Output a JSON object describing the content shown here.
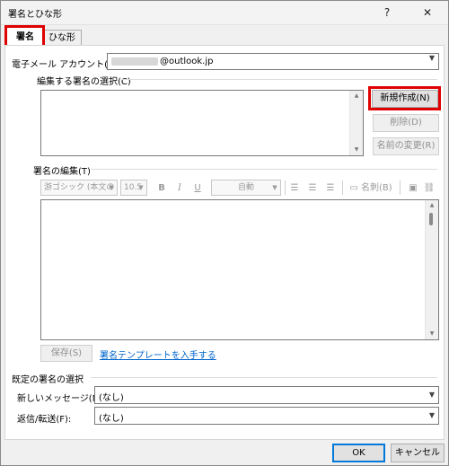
{
  "window": {
    "title": "署名とひな形",
    "help_label": "?",
    "close_label": "✕"
  },
  "tabs": [
    {
      "label": "署名"
    },
    {
      "label": "ひな形"
    }
  ],
  "email": {
    "label": "電子メール アカウント(A):",
    "value_suffix": "@outlook.jp"
  },
  "select_section": {
    "label": "編集する署名の選択(C)"
  },
  "buttons": {
    "new": "新規作成(N)",
    "delete": "削除(D)",
    "rename": "名前の変更(R)",
    "save": "保存(S)",
    "ok": "OK",
    "cancel": "キャンセル"
  },
  "edit_section": {
    "label": "署名の編集(T)"
  },
  "toolbar": {
    "font": "游ゴシック (本文の",
    "size": "10.5",
    "bold": "B",
    "italic": "I",
    "underline": "U",
    "color": "自動",
    "business_card": "名刺(B)"
  },
  "template_link": "署名テンプレートを入手する",
  "default_section": {
    "label": "既定の署名の選択",
    "new_message_label": "新しいメッセージ(M):",
    "new_message_value": "(なし)",
    "reply_label": "返信/転送(F):",
    "reply_value": "(なし)"
  },
  "colors": {
    "highlight": "#e00000",
    "link": "#0066cc",
    "focus": "#0078d7"
  }
}
